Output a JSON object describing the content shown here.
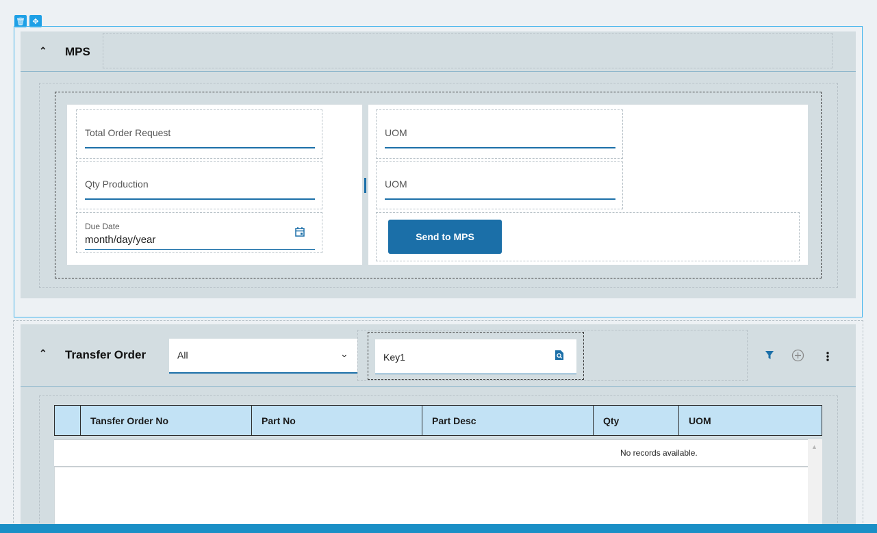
{
  "toolbar": {
    "delete_icon": "trash-icon",
    "move_icon": "move-icon"
  },
  "mps": {
    "title": "MPS",
    "fields": {
      "total_order_request": "Total Order Request",
      "qty_production": "Qty Production",
      "due_date_label": "Due Date",
      "due_date_value": "month/day/year",
      "uom_1": "UOM",
      "uom_2": "UOM"
    },
    "send_button": "Send to MPS"
  },
  "transfer_order": {
    "title": "Transfer Order",
    "filter_value": "All",
    "search_value": "Key1",
    "grid": {
      "columns": [
        "Tansfer Order No",
        "Part No",
        "Part Desc",
        "Qty",
        "UOM"
      ],
      "empty_message": "No records available."
    }
  },
  "colors": {
    "accent": "#1b6fa8",
    "panel": "#d3dde1",
    "grid_header": "#c2e2f5",
    "selection": "#1ea0e6"
  }
}
